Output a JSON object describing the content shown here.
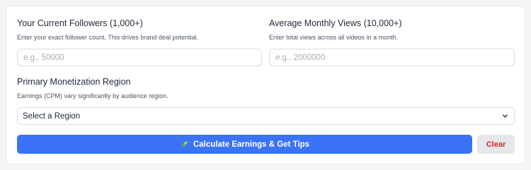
{
  "followers": {
    "label": "Your Current Followers (1,000+)",
    "help": "Enter your exact follower count. This drives brand deal potential.",
    "placeholder": "e.g., 50000",
    "value": ""
  },
  "views": {
    "label": "Average Monthly Views (10,000+)",
    "help": "Enter total views across all videos in a month.",
    "placeholder": "e.g., 2000000",
    "value": ""
  },
  "region": {
    "label": "Primary Monetization Region",
    "help": "Earnings (CPM) vary significantly by audience region.",
    "selected": "Select a Region",
    "icon": "chevron-down-icon"
  },
  "actions": {
    "calculate_label": "Calculate Earnings & Get Tips",
    "calculate_icon": "rocket-icon",
    "clear_label": "Clear"
  },
  "colors": {
    "primary": "#3b73f7",
    "clear_text": "#dc2626",
    "clear_bg": "#e5e7eb"
  }
}
